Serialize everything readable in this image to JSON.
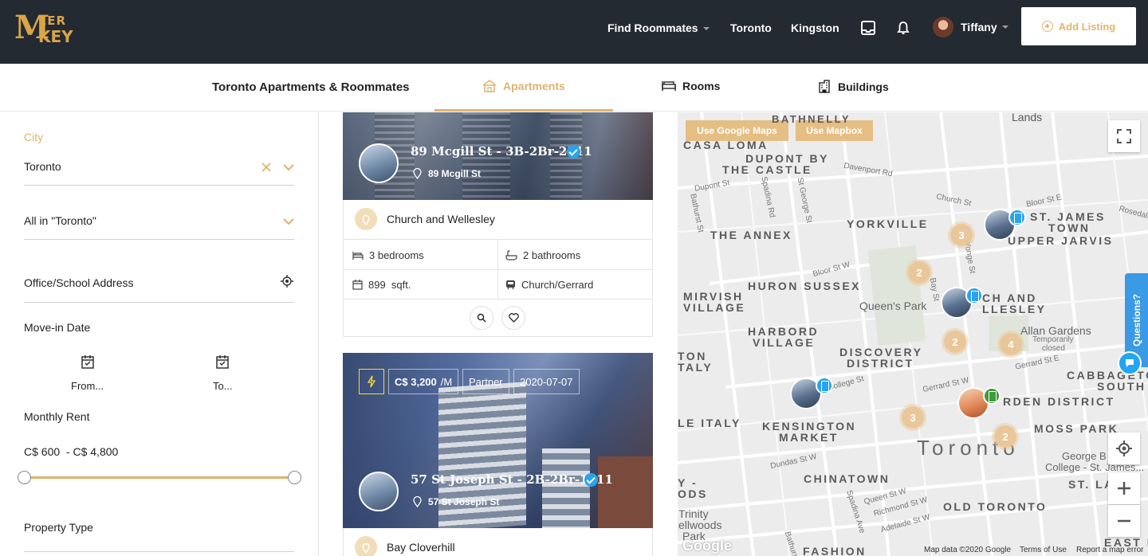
{
  "header": {
    "logo": "MEER KEY",
    "nav": {
      "find_roommates": "Find Roommates",
      "toronto": "Toronto",
      "kingston": "Kingston"
    },
    "user_name": "Tiffany",
    "add_listing": "Add Listing"
  },
  "tabs": {
    "heading": "Toronto Apartments & Roommates",
    "apartments": "Apartments",
    "rooms": "Rooms",
    "buildings": "Buildings",
    "active": "Apartments"
  },
  "filters": {
    "city_label": "City",
    "city_value": "Toronto",
    "area_value": "All in \"Toronto\"",
    "office_placeholder": "Office/School Address",
    "move_in_label": "Move-in Date",
    "from_label": "From...",
    "to_label": "To...",
    "monthly_rent_label": "Monthly Rent",
    "rent_range": "C$ 600  - C$ 4,800",
    "property_type_label": "Property Type"
  },
  "listings": [
    {
      "title": "89 Mcgill St - 3B-2Br-2511",
      "address": "89 Mcgill St",
      "neighbourhood": "Church and Wellesley",
      "bedrooms": "3 bedrooms",
      "bathrooms": "2 bathrooms",
      "size": "899  sqft.",
      "transit": "Church/Gerrard"
    },
    {
      "price": "C$ 3,200",
      "price_unit": "/M",
      "partner": "Partner",
      "date": "2020-07-07",
      "title": "57 St Joseph St - 2B-2Br-1211",
      "address": "57 St Joseph St",
      "neighbourhood": "Bay Cloverhill"
    }
  ],
  "map": {
    "use_google": "Use Google Maps",
    "use_mapbox": "Use Mapbox",
    "labels": {
      "casa_loma": "CASA LOMA",
      "dupont1": "DUPONT BY",
      "dupont2": "THE CASTLE",
      "bathnelly": "BATHNELLY",
      "lands": "Lands",
      "yorkville": "YORKVILLE",
      "annex": "THE ANNEX",
      "st_james1": "ST. JAMES",
      "st_james2": "TOWN",
      "upper_jarvis": "UPPER JARVIS",
      "huron": "HURON SUSSEX",
      "mirvish1": "MIRVISH",
      "mirvish2": "VILLAGE",
      "church1": "CH AND",
      "church2": "LLESLEY",
      "queens_park": "Queen's Park",
      "harbord1": "HARBORD",
      "harbord2": "VILLAGE",
      "allan": "Allan Gardens",
      "allan_note1": "Temporarily",
      "allan_note2": "closed",
      "discovery1": "DISCOVERY",
      "discovery2": "DISTRICT",
      "ton": "TON",
      "taly": "TALY",
      "cabbagetown1": "CABBAGETO",
      "cabbagetown2": "SOUTH",
      "garden": "RDEN DISTRICT",
      "little_italy": "LE ITALY",
      "kensington1": "KENSINGTON",
      "kensington2": "MARKET",
      "moss_park": "MOSS PARK",
      "toronto": "Toronto",
      "george_brown1": "George B",
      "george_brown2": "College - St. James...",
      "chinatown": "CHINATOWN",
      "st_lawrence": "ST. LA",
      "ods1": "Y -",
      "ods2": "ODS",
      "trinity1": "Trinity",
      "trinity2": "ellwoods",
      "trinity3": "Park",
      "old_toronto": "OLD TORONTO",
      "fashion": "FASHION",
      "east_bay": "EAST BAY"
    },
    "streets": {
      "davenport": "Davenport Rd",
      "dupont": "Dupont St",
      "spadina": "Spadina Rd",
      "st_george": "St George St",
      "bathurst": "Bathurst St",
      "church": "Church St",
      "bloor_e": "Bloor St E",
      "rosedale": "Rosedale",
      "yonge": "Yonge St",
      "bloor_w": "Bloor St W",
      "bay": "Bay St",
      "college": "College St",
      "gerrard_w": "Gerrard St W",
      "gerrard_e": "Gerrard St E",
      "dundas": "Dundas St W",
      "queen": "Queen St W",
      "richmond": "Richmond St W",
      "adelaide": "Adelaide St W",
      "spadina_ave": "Spadina Ave",
      "bathurst_s": "Bathurst"
    },
    "clusters": [
      "3",
      "2",
      "2",
      "4",
      "3",
      "2"
    ],
    "questions": "Questions?",
    "footer_data": "Map data ©2020 Google",
    "footer_terms": "Terms of Use",
    "footer_report": "Report a map error",
    "google": "Google"
  },
  "colors": {
    "gold": "#e0b36c",
    "header_bg": "#242a31",
    "verified_blue": "#2aa3ef"
  }
}
